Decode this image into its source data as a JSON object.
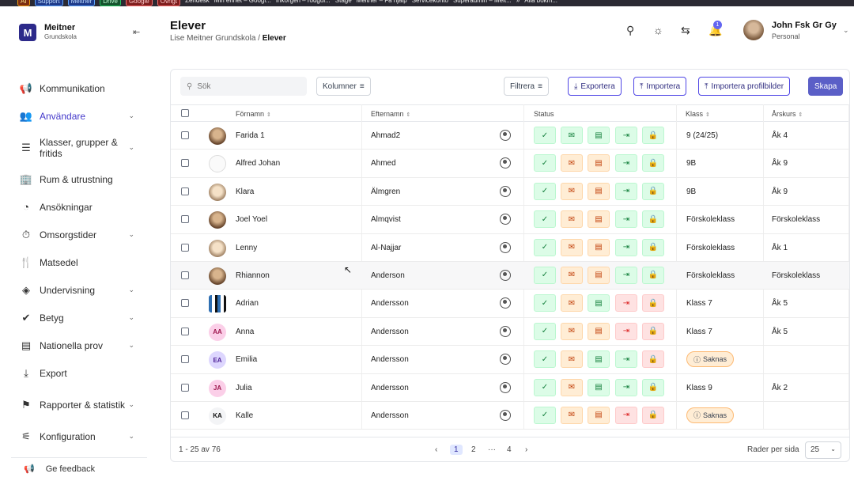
{
  "bookmarks": [
    "AI",
    "Support",
    "Meitner",
    "Drive",
    "Google",
    "Övrigt",
    "Zendesk",
    "Min enhet – Googl...",
    "Inkorgen – rodgul...",
    "Stage",
    "Meitner – Få hjälp",
    "Servicekonto",
    "Superadmin – Meit...",
    "»",
    "Alla bokm..."
  ],
  "brand": {
    "name": "Meitner",
    "sub": "Grundskola",
    "logo_letter": "M"
  },
  "nav": [
    {
      "label": "Kommunikation",
      "icon": "megaphone-icon",
      "glyph": "📢",
      "chevron": false
    },
    {
      "label": "Användare",
      "icon": "users-icon",
      "glyph": "👥",
      "chevron": true,
      "active": true
    },
    {
      "label": "Klasser, grupper & fritids",
      "icon": "list-icon",
      "glyph": "☰",
      "chevron": true
    },
    {
      "label": "Rum & utrustning",
      "icon": "building-icon",
      "glyph": "🏢",
      "chevron": false
    },
    {
      "label": "Ansökningar",
      "icon": "gauge-icon",
      "glyph": "◔",
      "chevron": false
    },
    {
      "label": "Omsorgstider",
      "icon": "clock-icon",
      "glyph": "⏱",
      "chevron": true
    },
    {
      "label": "Matsedel",
      "icon": "fork-knife-icon",
      "glyph": "🍴",
      "chevron": false
    },
    {
      "label": "Undervisning",
      "icon": "layers-icon",
      "glyph": "◈",
      "chevron": true
    },
    {
      "label": "Betyg",
      "icon": "check-circle-icon",
      "glyph": "✔",
      "chevron": true
    },
    {
      "label": "Nationella prov",
      "icon": "doc-icon",
      "glyph": "▤",
      "chevron": true
    },
    {
      "label": "Export",
      "icon": "download-icon",
      "glyph": "⤓",
      "chevron": false
    },
    {
      "label": "Rapporter & statistik",
      "icon": "flag-icon",
      "glyph": "⚑",
      "chevron": true
    },
    {
      "label": "Konfiguration",
      "icon": "sliders-icon",
      "glyph": "⚟",
      "chevron": true
    }
  ],
  "feedback": "Ge feedback",
  "header": {
    "title": "Elever",
    "breadcrumb_parent": "Lise Meitner Grundskola",
    "breadcrumb_sep": "/",
    "breadcrumb_current": "Elever",
    "notifications": "1",
    "user_name": "John Fsk Gr Gy",
    "user_role": "Personal"
  },
  "toolbar": {
    "search_placeholder": "Sök",
    "columns": "Kolumner",
    "filter": "Filtrera",
    "export": "Exportera",
    "import": "Importera",
    "import_photos": "Importera profilbilder",
    "create": "Skapa"
  },
  "columns": {
    "first": "Förnamn",
    "last": "Efternamn",
    "status": "Status",
    "class": "Klass",
    "year": "Årskurs"
  },
  "rows": [
    {
      "first": "Farida 1",
      "last": "Ahmad2",
      "class": "9 (24/25)",
      "year": "Åk 4",
      "avatar": "photo",
      "status": [
        "green",
        "green",
        "green",
        "green",
        "green"
      ],
      "missing": false
    },
    {
      "first": "Alfred Johan",
      "last": "Ahmed",
      "class": "9B",
      "year": "Åk 9",
      "avatar": "sketch",
      "status": [
        "green",
        "orange",
        "orange",
        "green",
        "green"
      ],
      "missing": false
    },
    {
      "first": "Klara",
      "last": "Älmgren",
      "class": "9B",
      "year": "Åk 9",
      "avatar": "photo2",
      "status": [
        "green",
        "orange",
        "orange",
        "green",
        "green"
      ],
      "missing": false
    },
    {
      "first": "Joel Yoel",
      "last": "Almqvist",
      "class": "Förskoleklass",
      "year": "Förskoleklass",
      "avatar": "photo",
      "status": [
        "green",
        "orange",
        "orange",
        "green",
        "green"
      ],
      "missing": false
    },
    {
      "first": "Lenny",
      "last": "Al-Najjar",
      "class": "Förskoleklass",
      "year": "Åk 1",
      "avatar": "photo2",
      "status": [
        "green",
        "orange",
        "orange",
        "green",
        "green"
      ],
      "missing": false
    },
    {
      "first": "Rhiannon",
      "last": "Anderson",
      "class": "Förskoleklass",
      "year": "Förskoleklass",
      "avatar": "photo",
      "status": [
        "green",
        "orange",
        "orange",
        "green",
        "green"
      ],
      "missing": false,
      "hover": true
    },
    {
      "first": "Adrian",
      "last": "Andersson",
      "class": "Klass 7",
      "year": "Åk 5",
      "avatar": "photo3",
      "status": [
        "green",
        "orange",
        "green",
        "red",
        "red"
      ],
      "missing": false
    },
    {
      "first": "Anna",
      "last": "Andersson",
      "class": "Klass 7",
      "year": "Åk 5",
      "avatar": "AA",
      "status": [
        "green",
        "orange",
        "orange",
        "red",
        "red"
      ],
      "missing": false
    },
    {
      "first": "Emilia",
      "last": "Andersson",
      "class": "",
      "year": "",
      "avatar": "EA",
      "status": [
        "green",
        "orange",
        "green",
        "green",
        "red"
      ],
      "missing": true
    },
    {
      "first": "Julia",
      "last": "Andersson",
      "class": "Klass 9",
      "year": "Åk 2",
      "avatar": "JA",
      "status": [
        "green",
        "orange",
        "green",
        "green",
        "green"
      ],
      "missing": false
    },
    {
      "first": "Kalle",
      "last": "Andersson",
      "class": "",
      "year": "",
      "avatar": "KA",
      "status": [
        "green",
        "orange",
        "orange",
        "red",
        "red"
      ],
      "missing": true
    }
  ],
  "missing_label": "Saknas",
  "status_icons": [
    "✓",
    "✉",
    "▤",
    "⇥",
    "🔒"
  ],
  "footer": {
    "range": "1 - 25 av 76",
    "pages": [
      "1",
      "2",
      "···",
      "4"
    ],
    "rows_per_page_label": "Rader per sida",
    "rows_per_page": "25"
  },
  "colors": {
    "accent": "#5b5fc7",
    "green": "#dcfce7",
    "orange": "#ffedd5",
    "red": "#fee2e2"
  }
}
